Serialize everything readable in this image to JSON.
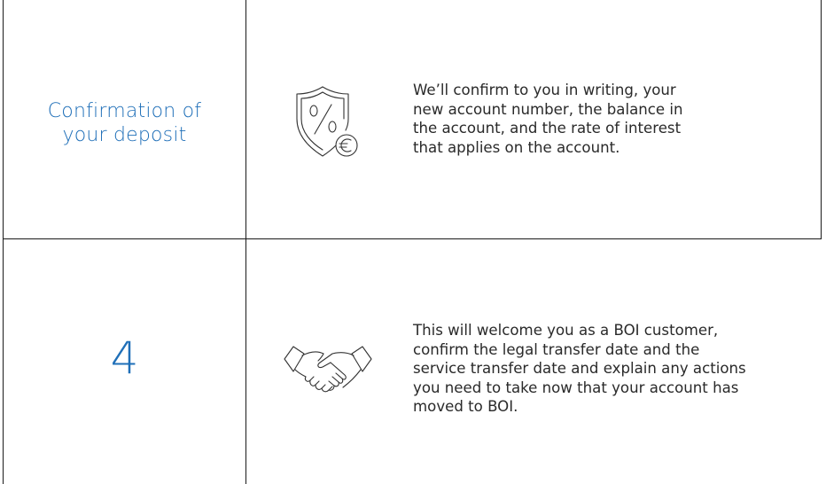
{
  "rows": [
    {
      "title": "Confirmation of\nyour deposit",
      "icon": "shield-percent-euro-icon",
      "description": "We’ll confirm to you in writing, your\nnew account number, the balance in\nthe account, and the rate of interest\nthat applies on the account."
    },
    {
      "title": "4",
      "icon": "handshake-icon",
      "description": "This will welcome you as a BOI customer,\nconfirm the legal transfer date and the\nservice transfer date and explain any actions\nyou need to take now that your account has\nmoved to BOI."
    }
  ],
  "colors": {
    "title": "#1f6fb8",
    "text": "#2a2a2a",
    "line": "#1a1a1a"
  }
}
